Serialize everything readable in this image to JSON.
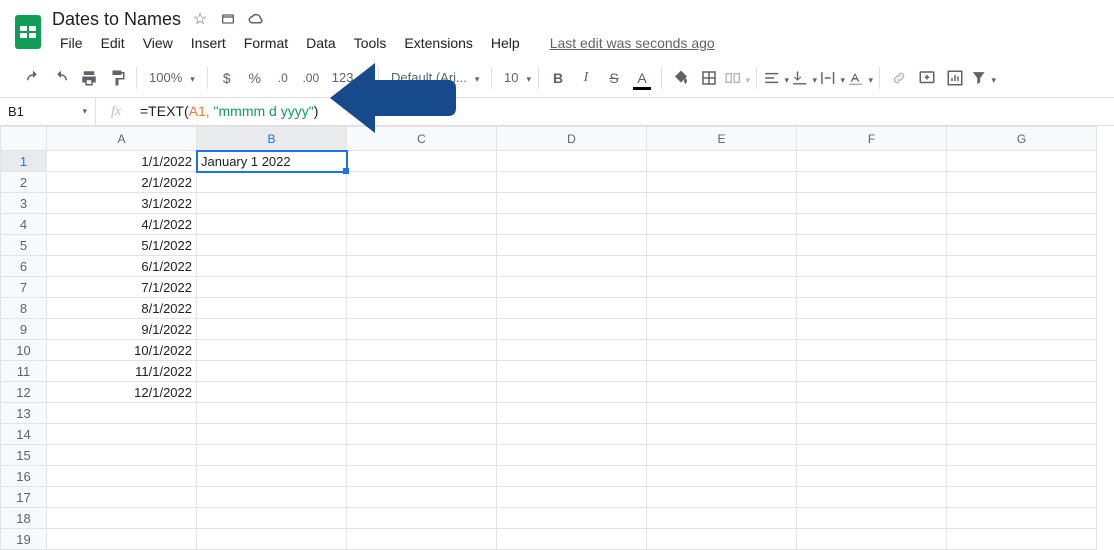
{
  "doc_title": "Dates to Names",
  "menus": [
    "File",
    "Edit",
    "View",
    "Insert",
    "Format",
    "Data",
    "Tools",
    "Extensions",
    "Help"
  ],
  "last_edit": "Last edit was seconds ago",
  "toolbar": {
    "zoom": "100%",
    "font": "Default (Ari...",
    "font_size": "10",
    "more_formats": "123"
  },
  "name_box": "B1",
  "formula": {
    "fn": "=TEXT",
    "open": "(",
    "ref": "A1",
    "comma": ", ",
    "str": "\"mmmm d yyyy\"",
    "close": ")"
  },
  "columns": [
    "A",
    "B",
    "C",
    "D",
    "E",
    "F",
    "G"
  ],
  "row_count": 19,
  "cells": {
    "A1": "1/1/2022",
    "A2": "2/1/2022",
    "A3": "3/1/2022",
    "A4": "4/1/2022",
    "A5": "5/1/2022",
    "A6": "6/1/2022",
    "A7": "7/1/2022",
    "A8": "8/1/2022",
    "A9": "9/1/2022",
    "A10": "10/1/2022",
    "A11": "11/1/2022",
    "A12": "12/1/2022",
    "B1": "January 1 2022"
  },
  "selected": "B1"
}
